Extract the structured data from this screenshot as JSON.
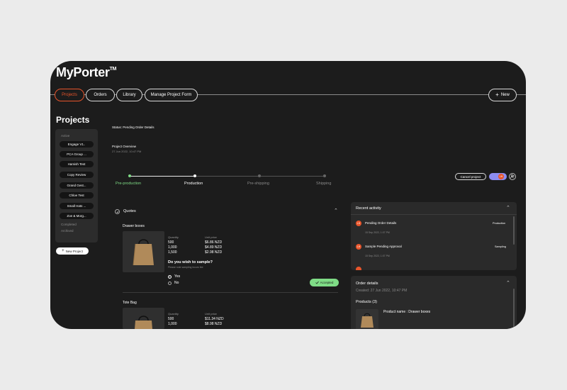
{
  "app": {
    "title": "MyPorter",
    "tm": "TM"
  },
  "nav": {
    "tabs": [
      {
        "label": "Projects",
        "active": true
      },
      {
        "label": "Orders"
      },
      {
        "label": "Library"
      },
      {
        "label": "Manage Project Form"
      }
    ],
    "new_label": "New"
  },
  "sidebar": {
    "title": "Projects",
    "active_caption": "Active",
    "items": [
      "Engage V1..",
      "PCA Group ...",
      "Hamish Test",
      "Copy Review",
      "Grand Gest...",
      "Chloe Test",
      "Small Hats ...",
      "Zoe & Morg..."
    ],
    "completed_caption": "Completed",
    "archived_caption": "Archived",
    "new_project_label": "New Project"
  },
  "project": {
    "status": "Status: Pending Order Details",
    "overview_title": "Project Overview",
    "overview_date": "27 Jun 2022, 10:47 PM",
    "cancel_label": "Cancel project",
    "avatar_initials": "LH",
    "steps": [
      {
        "label": "Pre-production",
        "state": "done"
      },
      {
        "label": "Production",
        "state": "current"
      },
      {
        "label": "Pre-shipping",
        "state": "pending"
      },
      {
        "label": "Shipping",
        "state": "pending"
      }
    ]
  },
  "quotes": {
    "title": "Quotes",
    "products": [
      {
        "name": "Drawer boxes",
        "qty_header": "Quantity",
        "price_header": "Unit price",
        "rows": [
          [
            "500",
            "$6.86 NZD"
          ],
          [
            "1,000",
            "$4.89 NZD"
          ],
          [
            "1,500",
            "$2.98 NZD"
          ]
        ],
        "sample_question": "Do you wish to sample?",
        "sample_note": "Please note sampling incurs fee",
        "options": [
          "Yes",
          "No"
        ],
        "accepted_label": "Accepted"
      },
      {
        "name": "Tote Bag",
        "qty_header": "Quantity",
        "price_header": "Unit price",
        "rows": [
          [
            "500",
            "$11.34 NZD"
          ],
          [
            "1,000",
            "$8.98 NZD"
          ]
        ]
      }
    ]
  },
  "activity": {
    "title": "Recent activity",
    "items": [
      {
        "initials": "LH",
        "text": "Pending Order Details",
        "date": "15 Sep 2022, 1:07 PM",
        "tag": "Production"
      },
      {
        "initials": "LH",
        "text": "Sample Pending Approval",
        "date": "15 Sep 2022, 1:07 PM",
        "tag": "Sampling"
      }
    ]
  },
  "order": {
    "title": "Order details",
    "created": "Created: 27 Jun 2022, 10:47 PM",
    "products_title": "Products (3)",
    "product_name": "Product name : Drawer boxes"
  },
  "colors": {
    "accent": "#e8552b",
    "green": "#7fdc86",
    "bg": "#1c1c1c",
    "panel": "#2a2a2a"
  }
}
